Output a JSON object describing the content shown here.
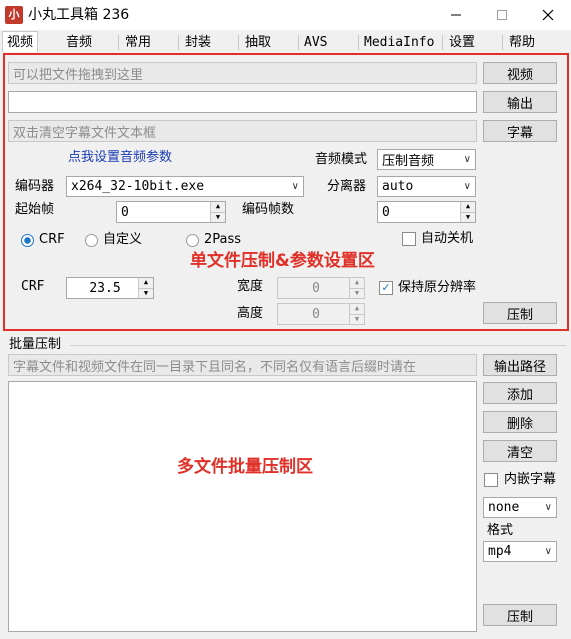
{
  "window": {
    "title": "小丸工具箱 236",
    "icon_text": "小"
  },
  "tabs": [
    {
      "label": "视频"
    },
    {
      "label": "音频"
    },
    {
      "label": "常用"
    },
    {
      "label": "封装"
    },
    {
      "label": "抽取"
    },
    {
      "label": "AVS"
    },
    {
      "label": "MediaInfo"
    },
    {
      "label": "设置"
    },
    {
      "label": "帮助"
    }
  ],
  "single": {
    "video_input_placeholder": "可以把文件拖拽到这里",
    "output_value": "",
    "subtitle_placeholder": "双击清空字幕文件文本框",
    "video_btn": "视频",
    "output_btn": "输出",
    "subtitle_btn": "字幕",
    "audio_settings_link": "点我设置音频参数",
    "audio_mode_label": "音频模式",
    "audio_mode_value": "压制音频",
    "encoder_label": "编码器",
    "encoder_value": "x264_32-10bit.exe",
    "demuxer_label": "分离器",
    "demuxer_value": "auto",
    "start_frame_label": "起始帧",
    "start_frame_value": "0",
    "frame_count_label": "编码帧数",
    "frame_count_value": "0",
    "mode_crf": "CRF",
    "mode_custom": "自定义",
    "mode_2pass": "2Pass",
    "auto_shutdown": "自动关机",
    "crf_label": "CRF",
    "crf_value": "23.5",
    "width_label": "宽度",
    "width_value": "0",
    "height_label": "高度",
    "height_value": "0",
    "keep_res": "保持原分辨率",
    "encode_btn": "压制",
    "annotation": "单文件压制&参数设置区"
  },
  "batch": {
    "group_label": "批量压制",
    "hint": "字幕文件和视频文件在同一目录下且同名，不同名仅有语言后缀时请在",
    "output_path_btn": "输出路径",
    "add_btn": "添加",
    "delete_btn": "删除",
    "clear_btn": "清空",
    "embed_sub": "内嵌字幕",
    "sub_select_value": "none",
    "format_label": "格式",
    "format_value": "mp4",
    "encode_btn": "压制",
    "annotation": "多文件批量压制区"
  },
  "colors": {
    "annotation": "#e03028",
    "link": "#1a3cb4",
    "accent": "#1d75c8"
  }
}
